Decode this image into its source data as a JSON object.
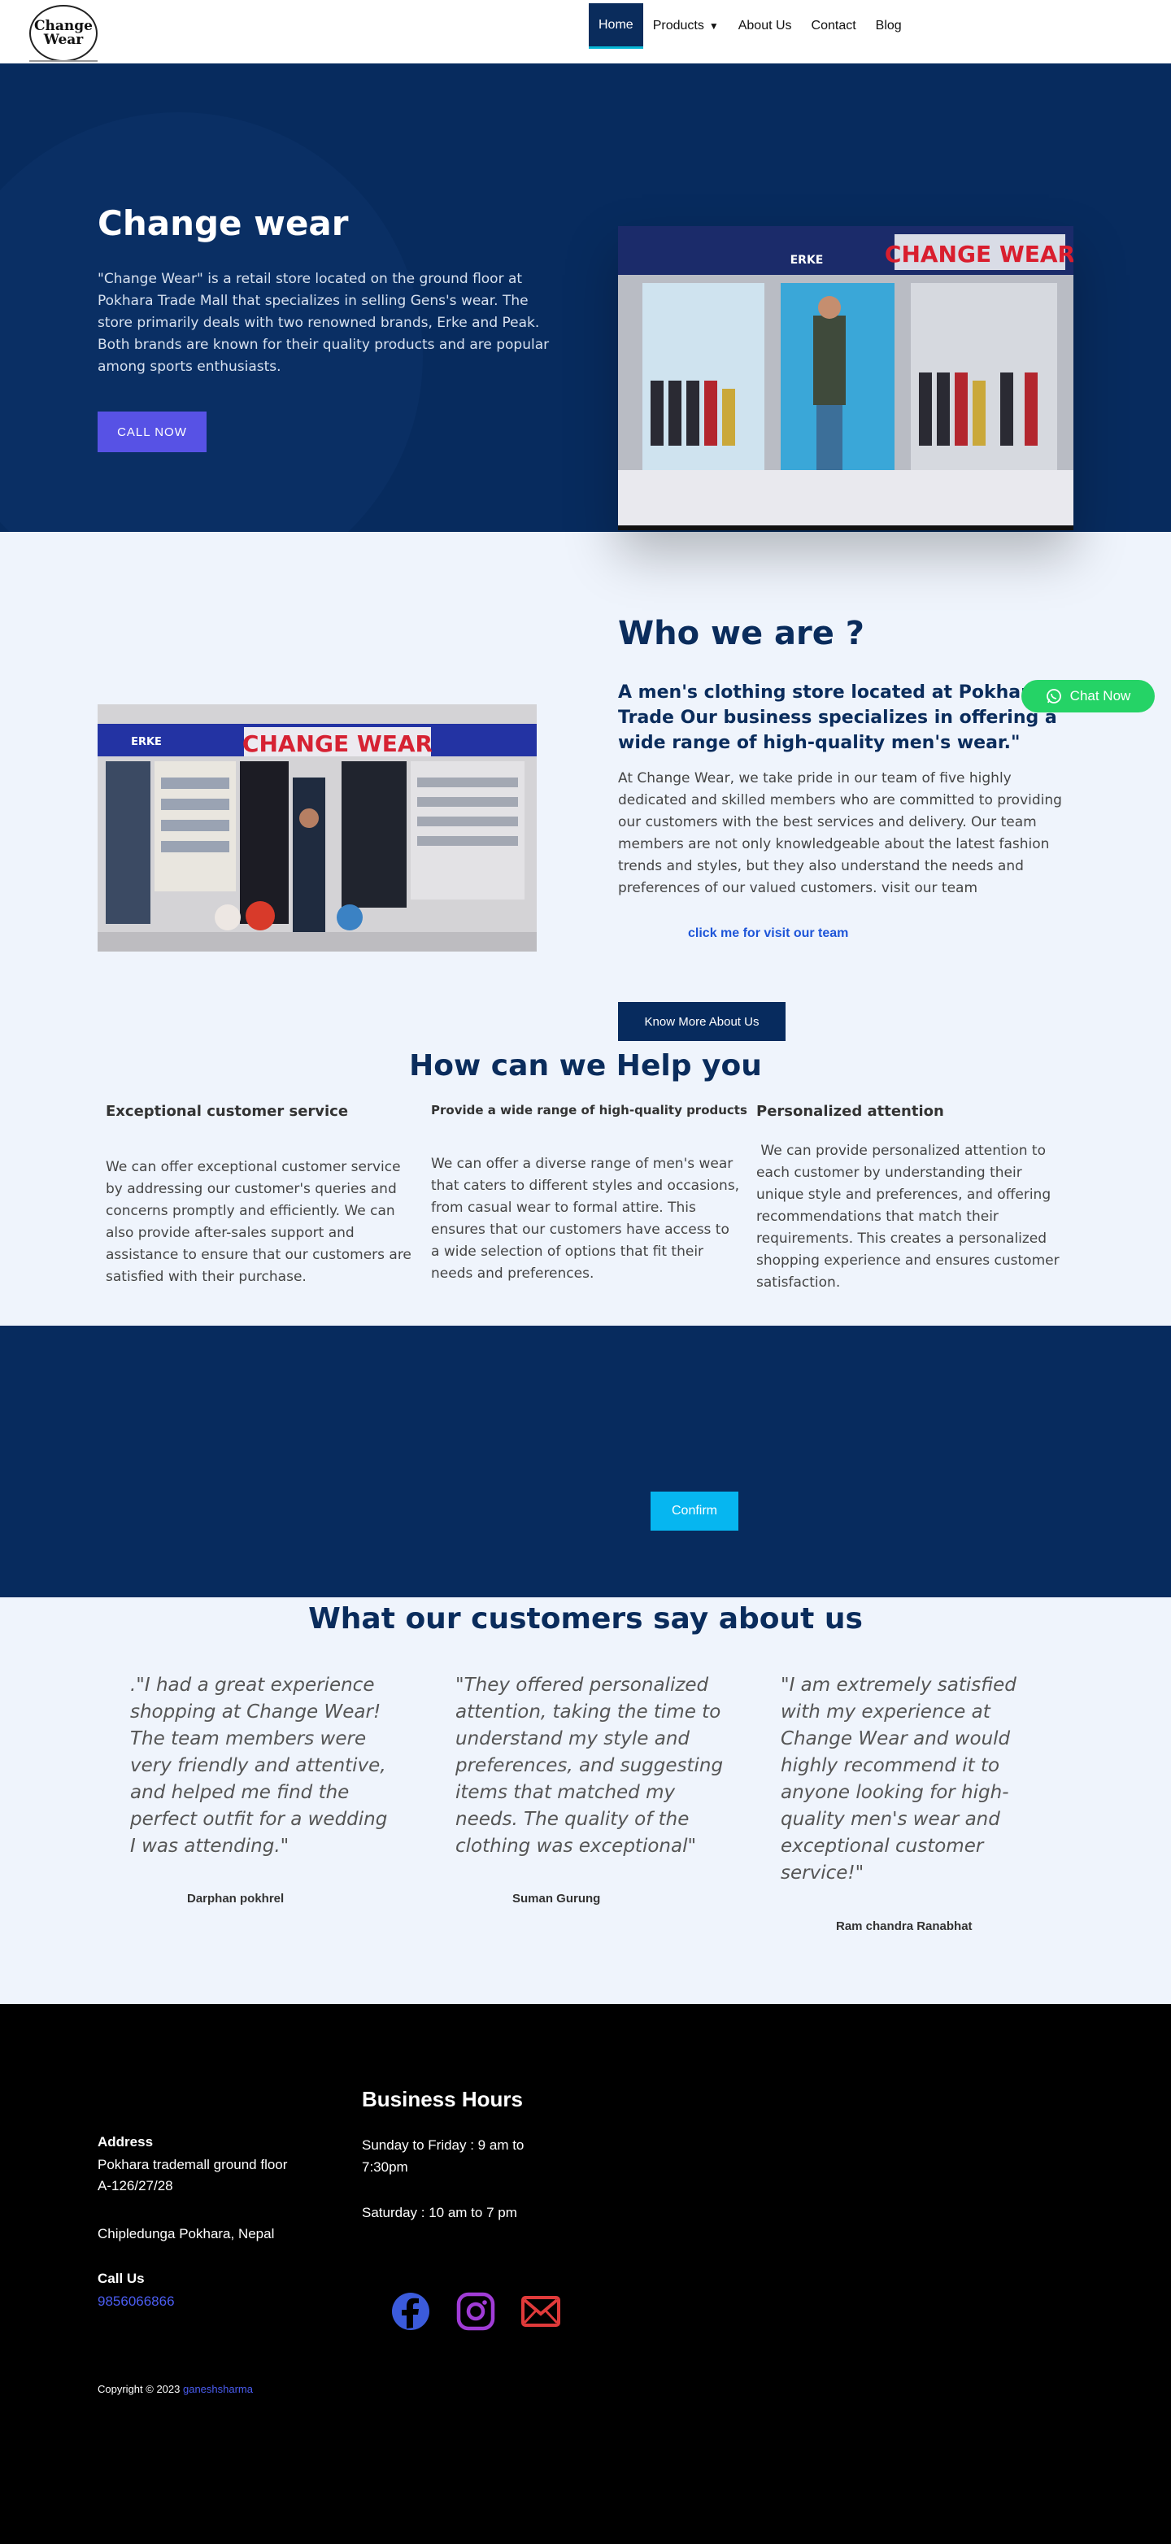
{
  "header": {
    "logo_line1": "Change",
    "logo_line2": "Wear",
    "nav": [
      {
        "label": "Home",
        "active": true
      },
      {
        "label": "Products",
        "dropdown": true
      },
      {
        "label": "About Us"
      },
      {
        "label": "Contact"
      },
      {
        "label": "Blog"
      }
    ]
  },
  "hero": {
    "title": "Change wear",
    "text": "\"Change Wear\" is a retail store located on the ground floor at Pokhara Trade Mall that specializes in selling Gens's wear. The store primarily deals with two renowned brands, Erke and Peak. Both brands are known for their quality products and are popular among sports enthusiasts.",
    "button": "CALL NOW",
    "photo_sign": "CHANGE WEAR",
    "photo_brand": "ERKE"
  },
  "about": {
    "title": "Who we are ?",
    "subtitle": "A men's clothing store located at Pokhara Trade Our business specializes in offering a wide range of high-quality men's wear.\"",
    "text": "At Change Wear, we take pride in our team of five highly dedicated and skilled members who are committed to providing our customers with the best services and delivery. Our team members are not only knowledgeable about the latest fashion trends and styles, but they also understand the needs and preferences of our valued customers. visit our team",
    "link": "click me for visit our team",
    "button": "Know More About Us",
    "photo_sign": "CHANGE WEAR",
    "photo_brand": "ERKE"
  },
  "chat": {
    "label": "Chat Now"
  },
  "help": {
    "title": "How can we Help you",
    "columns": [
      {
        "title": "Exceptional customer service",
        "text": "We can offer exceptional customer service by addressing our customer's queries and concerns promptly and efficiently. We can also provide after-sales support and assistance to ensure that our customers are satisfied with their purchase."
      },
      {
        "title": "Provide a wide range of high-quality products",
        "text": "We can offer a diverse range of men's wear that caters to different styles and occasions, from casual wear to formal attire. This ensures that our customers have access to a wide selection of options that fit their needs and preferences."
      },
      {
        "title": "Personalized attention",
        "text": " We can provide personalized attention to each customer by understanding their unique style and preferences, and offering recommendations that match their requirements. This creates a personalized shopping experience and ensures customer satisfaction."
      }
    ]
  },
  "band": {
    "button": "Confirm"
  },
  "testimonials": {
    "title": "What our customers say about us",
    "items": [
      {
        "quote": ".\"I had a great experience shopping at Change Wear! The team members were very friendly and attentive, and helped me find the perfect outfit for a wedding I was attending.\"",
        "author": "Darphan pokhrel"
      },
      {
        "quote": "\"They offered personalized attention, taking the time to understand my style and preferences, and suggesting items that matched my needs. The quality of the clothing was exceptional\"",
        "author": "Suman Gurung"
      },
      {
        "quote": "\"I am extremely satisfied with my experience at Change Wear and would highly recommend it to anyone looking for high-quality men's wear and exceptional customer service!\"",
        "author": "Ram chandra Ranabhat"
      }
    ]
  },
  "footer": {
    "address_label": "Address",
    "address_line1": "Pokhara trademall ground floor",
    "address_line2": "A-126/27/28",
    "address_line3": "Chipledunga Pokhara, Nepal",
    "call_label": "Call Us",
    "phone": "9856066866",
    "hours_title": "Business Hours",
    "hours_1": "Sunday to Friday : 9 am to 7:30pm",
    "hours_2": "Saturday : 10 am to 7 pm",
    "copyright_prefix": "Copyright © 2023",
    "copyright_author": "ganeshsharma",
    "colors": {
      "facebook": "#3b5bdb",
      "instagram": "#a03cd6",
      "email": "#e03a3a"
    }
  },
  "colors": {
    "navy": "#072b5e",
    "accent": "#5752e5",
    "cyan": "#06b6f0",
    "chat": "#25d366",
    "background": "#eff4fc"
  }
}
